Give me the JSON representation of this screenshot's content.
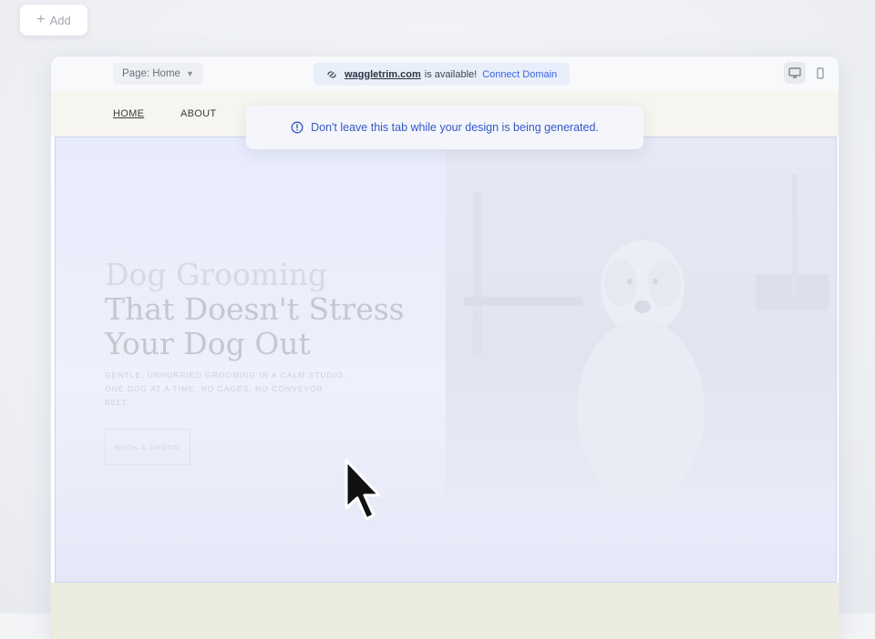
{
  "toolbar_add": {
    "label": "Add"
  },
  "editor": {
    "page_selector": {
      "label": "Page: Home"
    },
    "domain_banner": {
      "domain": "waggletrim.com",
      "available_text": "is available!",
      "connect_label": "Connect Domain"
    },
    "devices": [
      "desktop-icon",
      "mobile-icon"
    ]
  },
  "notice": {
    "text": "Don't leave this tab while your design is being generated."
  },
  "site": {
    "nav": {
      "home": "HOME",
      "about": "ABOUT"
    },
    "hero": {
      "title_line1": "Dog Grooming",
      "title_line2": "That Doesn't Stress",
      "title_line3": "Your Dog Out",
      "subtitle": "GENTLE, UNHURRIED GROOMING IN A CALM STUDIO. ONE DOG AT A TIME, NO CAGES, NO CONVEYOR BELT.",
      "cta": "BOOK A GROOM"
    }
  },
  "colors": {
    "accent": "#3b63e0",
    "notice_text": "#3557c6",
    "hero_border": "#c9d3f2",
    "nav_bg": "#f6f5ef"
  }
}
